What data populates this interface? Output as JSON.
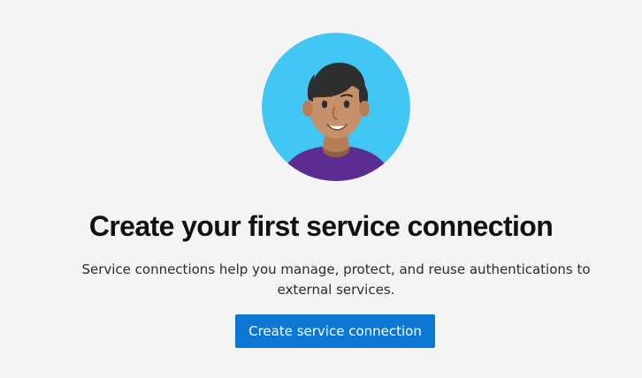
{
  "empty_state": {
    "title": "Create your first service connection",
    "description": "Service connections help you manage, protect, and reuse authentications to external services.",
    "button_label": "Create service connection"
  },
  "colors": {
    "page_background": "#f4f4f4",
    "primary_button": "#0b78d4",
    "avatar_background": "#42c7f4",
    "avatar_shirt": "#5b2d91",
    "avatar_skin": "#c6916a",
    "avatar_hair": "#2e2e2e"
  },
  "icons": {
    "illustration": "person-avatar-icon"
  }
}
